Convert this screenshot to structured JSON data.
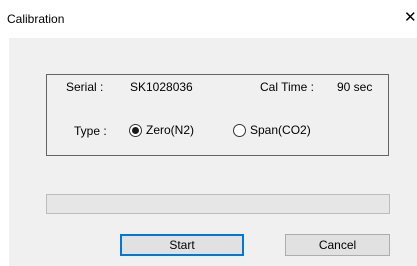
{
  "window": {
    "title": "Calibration",
    "close_glyph": "✕"
  },
  "info": {
    "serial_label": "Serial :",
    "serial_value": "SK1028036",
    "cal_time_label": "Cal Time :",
    "cal_time_value": "90 sec",
    "type_label": "Type  :"
  },
  "type_options": [
    {
      "label": "Zero(N2)",
      "selected": true
    },
    {
      "label": "Span(CO2)",
      "selected": false
    }
  ],
  "progress": {
    "value_fraction": 0
  },
  "buttons": {
    "start_label": "Start",
    "cancel_label": "Cancel"
  },
  "colors": {
    "accent": "#0078d7",
    "dialog_background": "#f0f0f0",
    "progress_fill": "#06b025"
  },
  "icons": {
    "close": "close-icon"
  }
}
